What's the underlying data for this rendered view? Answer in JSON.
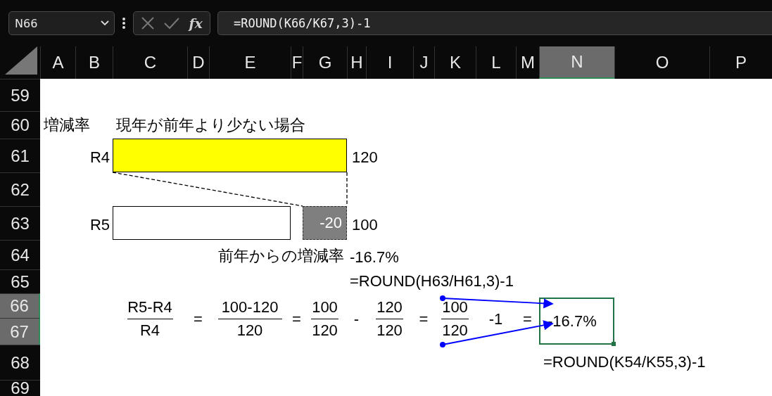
{
  "name_box": {
    "value": "N66"
  },
  "formula_bar": {
    "fx": "fx",
    "value": "=ROUND(K66/K67,3)-1"
  },
  "columns": [
    {
      "label": "A",
      "selected": false
    },
    {
      "label": "B",
      "selected": false
    },
    {
      "label": "C",
      "selected": false
    },
    {
      "label": "D",
      "selected": false
    },
    {
      "label": "E",
      "selected": false
    },
    {
      "label": "F",
      "selected": false
    },
    {
      "label": "G",
      "selected": false
    },
    {
      "label": "H",
      "selected": false
    },
    {
      "label": "I",
      "selected": false
    },
    {
      "label": "J",
      "selected": false
    },
    {
      "label": "K",
      "selected": false
    },
    {
      "label": "L",
      "selected": false
    },
    {
      "label": "M",
      "selected": false
    },
    {
      "label": "N",
      "selected": true
    },
    {
      "label": "O",
      "selected": false
    },
    {
      "label": "P",
      "selected": false
    }
  ],
  "rows": [
    {
      "label": "59",
      "selected": false
    },
    {
      "label": "60",
      "selected": false
    },
    {
      "label": "61",
      "selected": false
    },
    {
      "label": "62",
      "selected": false
    },
    {
      "label": "63",
      "selected": false
    },
    {
      "label": "64",
      "selected": false
    },
    {
      "label": "65",
      "selected": false
    },
    {
      "label": "66",
      "selected": true
    },
    {
      "label": "67",
      "selected": true
    },
    {
      "label": "68",
      "selected": false
    },
    {
      "label": "69",
      "selected": false
    }
  ],
  "heading": {
    "label": "増減率",
    "caption": "現年が前年より少ない場合"
  },
  "bars": [
    {
      "label": "R4",
      "value": "120",
      "color": "#ffff00"
    },
    {
      "label": "R5",
      "value": "100",
      "color": "#ffffff",
      "difference": "-20"
    }
  ],
  "change": {
    "label": "前年からの増減率",
    "value": "-16.7%",
    "formula": "=ROUND(H63/H61,3)-1"
  },
  "equation": {
    "terms": [
      {
        "kind": "fraction",
        "numerator": "R5-R4",
        "denominator": "R4"
      },
      {
        "kind": "symbol",
        "text": "="
      },
      {
        "kind": "fraction",
        "numerator": "100-120",
        "denominator": "120"
      },
      {
        "kind": "symbol",
        "text": "="
      },
      {
        "kind": "fraction",
        "numerator": "100",
        "denominator": "120"
      },
      {
        "kind": "symbol",
        "text": "-"
      },
      {
        "kind": "fraction",
        "numerator": "120",
        "denominator": "120"
      },
      {
        "kind": "symbol",
        "text": "="
      },
      {
        "kind": "fraction",
        "numerator": "100",
        "denominator": "120"
      },
      {
        "kind": "symbol",
        "text": "-1"
      },
      {
        "kind": "symbol",
        "text": "="
      }
    ],
    "result": {
      "value": "-16.7%",
      "selected": true
    },
    "formula": "=ROUND(K54/K55,3)-1"
  }
}
